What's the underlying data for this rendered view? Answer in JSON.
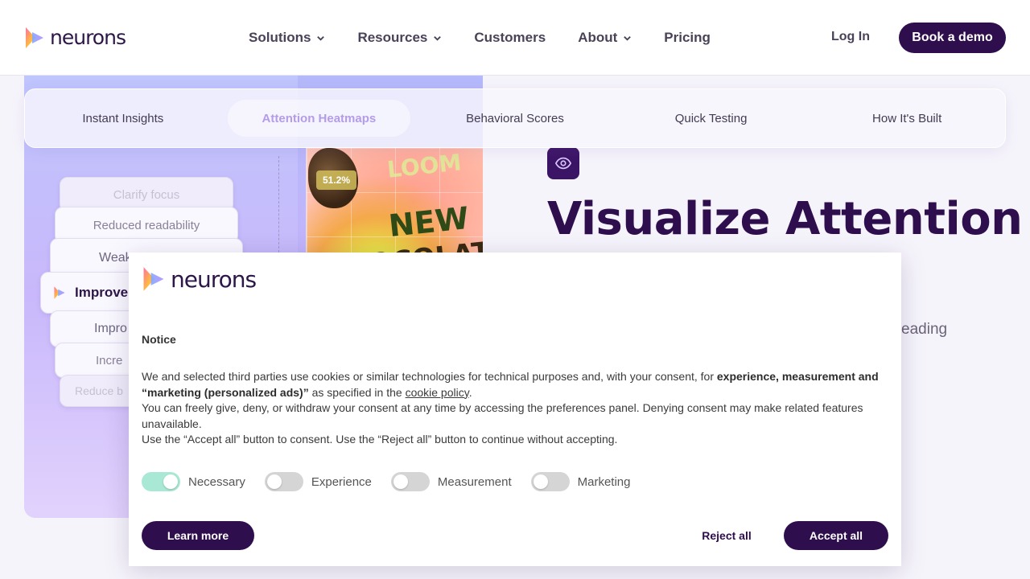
{
  "brand": {
    "name": "neurons"
  },
  "header": {
    "nav": [
      {
        "label": "Solutions",
        "has_dropdown": true
      },
      {
        "label": "Resources",
        "has_dropdown": true
      },
      {
        "label": "Customers",
        "has_dropdown": false
      },
      {
        "label": "About",
        "has_dropdown": true
      },
      {
        "label": "Pricing",
        "has_dropdown": false
      }
    ],
    "login_label": "Log In",
    "demo_label": "Book a demo"
  },
  "tabs": [
    {
      "label": "Instant Insights",
      "active": false
    },
    {
      "label": "Attention Heatmaps",
      "active": true
    },
    {
      "label": "Behavioral Scores",
      "active": false
    },
    {
      "label": "Quick Testing",
      "active": false
    },
    {
      "label": "How It's Built",
      "active": false
    }
  ],
  "visual": {
    "cards": [
      "Clarify focus",
      "Reduced readability",
      "Weak",
      "Improve",
      "Impro",
      "Incre",
      "Reduce b"
    ],
    "heatmap_badge": "51.2%",
    "heatmap_words": [
      "LOOM",
      "NEW",
      "CHOCOLAT"
    ]
  },
  "hero": {
    "title": "Visualize Attention",
    "snippet": "y-leading",
    "icon": "eye-icon"
  },
  "cookie": {
    "notice_title": "Notice",
    "body_line1_pre": "We and selected third parties use cookies or similar technologies for technical purposes and, with your consent, for ",
    "body_line1_bold": "experience, measurement and “marketing (personalized ads)”",
    "body_line1_mid": " as specified in the ",
    "body_link": "cookie policy",
    "body_line1_end": ".",
    "body_line2": "You can freely give, deny, or withdraw your consent at any time by accessing the preferences panel. Denying consent may make related features unavailable.",
    "body_line3": "Use the “Accept all” button to consent. Use the “Reject all” button to continue without accepting.",
    "toggles": [
      {
        "label": "Necessary",
        "on": true
      },
      {
        "label": "Experience",
        "on": false
      },
      {
        "label": "Measurement",
        "on": false
      },
      {
        "label": "Marketing",
        "on": false
      }
    ],
    "learn_more_label": "Learn more",
    "reject_label": "Reject all",
    "accept_label": "Accept all"
  },
  "colors": {
    "brand_dark": "#2f0e4e",
    "accent_tab": "#b59ce8",
    "toggle_on": "#a9e8d4"
  }
}
